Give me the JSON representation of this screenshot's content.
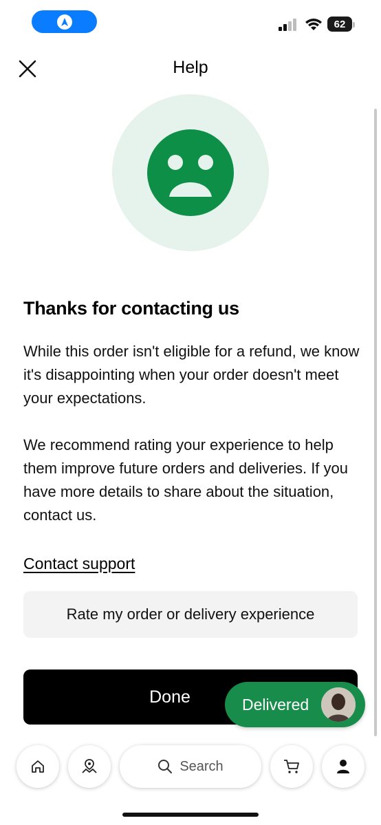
{
  "status_bar": {
    "battery": "62"
  },
  "header": {
    "title": "Help"
  },
  "main": {
    "heading": "Thanks for contacting us",
    "paragraph1": "While this order isn't eligible for a refund, we know it's disappointing when your order doesn't meet your expectations.",
    "paragraph2": "We recommend rating your experience to help them improve future orders and deliveries. If you have more details to share about the situation, contact us.",
    "contact_link": "Contact support",
    "rate_button": "Rate my order or delivery experience",
    "done_button": "Done"
  },
  "delivery_status": {
    "label": "Delivered"
  },
  "bottom_nav": {
    "search_label": "Search",
    "icons": [
      "home-icon",
      "map-pin-icon",
      "search-icon",
      "cart-icon",
      "account-icon"
    ]
  },
  "colors": {
    "accent_green": "#178c4b",
    "face_green": "#0d8f47",
    "face_bg": "#e6f3ec",
    "nav_pill_blue": "#0a7cff"
  }
}
